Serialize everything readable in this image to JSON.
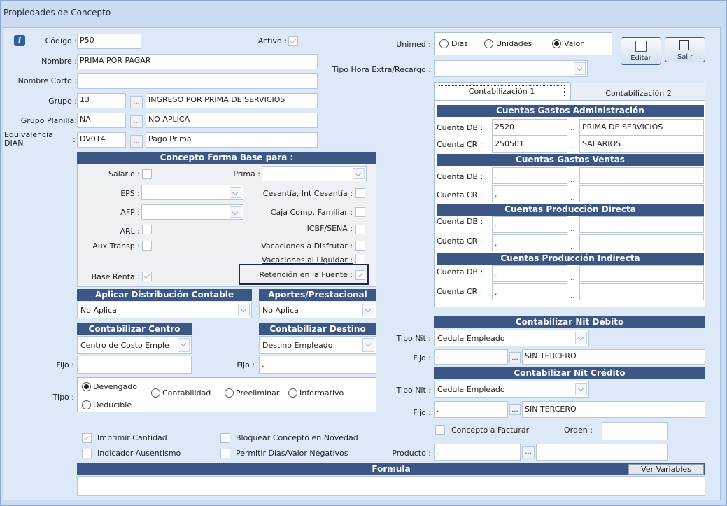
{
  "window": {
    "title": "Propiedades de Concepto"
  },
  "form": {
    "codigo_label": "Código :",
    "codigo": "P50",
    "activo_label": "Activo :",
    "nombre_label": "Nombre :",
    "nombre": "PRIMA POR PAGAR",
    "nombre_corto_label": "Nombre Corto :",
    "grupo_label": "Grupo :",
    "grupo_code": "13",
    "grupo_desc": "INGRESO POR PRIMA DE SERVICIOS",
    "grupo_planilla_label": "Grupo Planilla:",
    "grupo_planilla_code": "NA",
    "grupo_planilla_desc": "NO APLICA",
    "equiv_label_1": "Equivalencia",
    "equiv_label_2": "DIAN",
    "equiv_colon": ":",
    "equiv_code": "DV014",
    "equiv_desc": "Pago Prima",
    "dots": "..."
  },
  "base": {
    "header": "Concepto Forma Base para :",
    "salario": "Salario :",
    "prima": "Prima :",
    "eps": "EPS :",
    "cesantia": "Cesantía, Int Cesantía :",
    "afp": "AFP :",
    "caja": "Caja Comp. Familiar :",
    "arl": "ARL :",
    "icbf": "ICBF/SENA :",
    "aux": "Aux Transp :",
    "vac_disfrutar": "Vacaciones a Disfrutar :",
    "vac_liquidar": "Vacaciones al Liquidar :",
    "base_renta": "Base Renta :",
    "retencion": "Retención en la Fuente :"
  },
  "distribucion": {
    "header": "Aplicar Distribución Contable",
    "value": "No Aplica"
  },
  "aportes": {
    "header": "Aportes/Prestacional",
    "value": "No Aplica"
  },
  "centro": {
    "header": "Contabilizar Centro",
    "value": "Centro de Costo Emple",
    "fijo_label": "Fijo :"
  },
  "destino": {
    "header": "Contabilizar Destino",
    "value": "Destino Empleado",
    "fijo_label": "Fijo :",
    "fijo": "."
  },
  "tipo": {
    "label": "Tipo :",
    "options": [
      "Devengado",
      "Contabilidad",
      "Preeliminar",
      "Informativo",
      "Deducible"
    ]
  },
  "checks": {
    "imprimir": "Imprimir Cantidad",
    "bloquear": "Bloquear Concepto en Novedad",
    "ausentismo": "Indicador Ausentismo",
    "permitir": "Permitir Dias/Valor Negativos"
  },
  "formula": {
    "header": "Formula",
    "ver_variables": "Ver Variables"
  },
  "unimed": {
    "label": "Unimed :",
    "options": [
      "Dias",
      "Unidades",
      "Valor"
    ]
  },
  "tipo_hora": {
    "label": "Tipo Hora Extra/Recargo :"
  },
  "toolbar": {
    "editar": "Editar",
    "salir": "Salir"
  },
  "tabs": [
    "Contabilización 1",
    "Contabilización 2"
  ],
  "cuentas": {
    "admin_header": "Cuentas Gastos Administración",
    "ventas_header": "Cuentas Gastos Ventas",
    "prod_dir_header": "Cuentas Producción Directa",
    "prod_ind_header": "Cuentas Producción Indirecta",
    "db_label": "Cuenta DB :",
    "cr_label": "Cuenta CR :",
    "admin_db": "2520",
    "admin_db_desc": "PRIMA DE SERVICIOS",
    "admin_cr": "250501",
    "admin_cr_desc": "SALARIOS",
    "empty_val": ".",
    "dots2": ".."
  },
  "nit_debito": {
    "header": "Contabilizar Nit Débito",
    "tipo_label": "Tipo Nit :",
    "tipo": "Cedula Empleado",
    "fijo_label": "Fijo :",
    "fijo": ".",
    "tercero": "SIN TERCERO"
  },
  "nit_credito": {
    "header": "Contabilizar Nit Crédito",
    "tipo_label": "Tipo Nit :",
    "tipo": "Cedula Empleado",
    "fijo_label": "Fijo :",
    "fijo": ".",
    "tercero": "SIN TERCERO"
  },
  "facturar": {
    "label": "Concepto a Facturar",
    "orden_label": "Orden :",
    "producto_label": "Producto :",
    "producto": "."
  },
  "colors": {
    "section_header": "#3d5785",
    "background": "#dde9f7",
    "highlight": "#1a2a52"
  }
}
